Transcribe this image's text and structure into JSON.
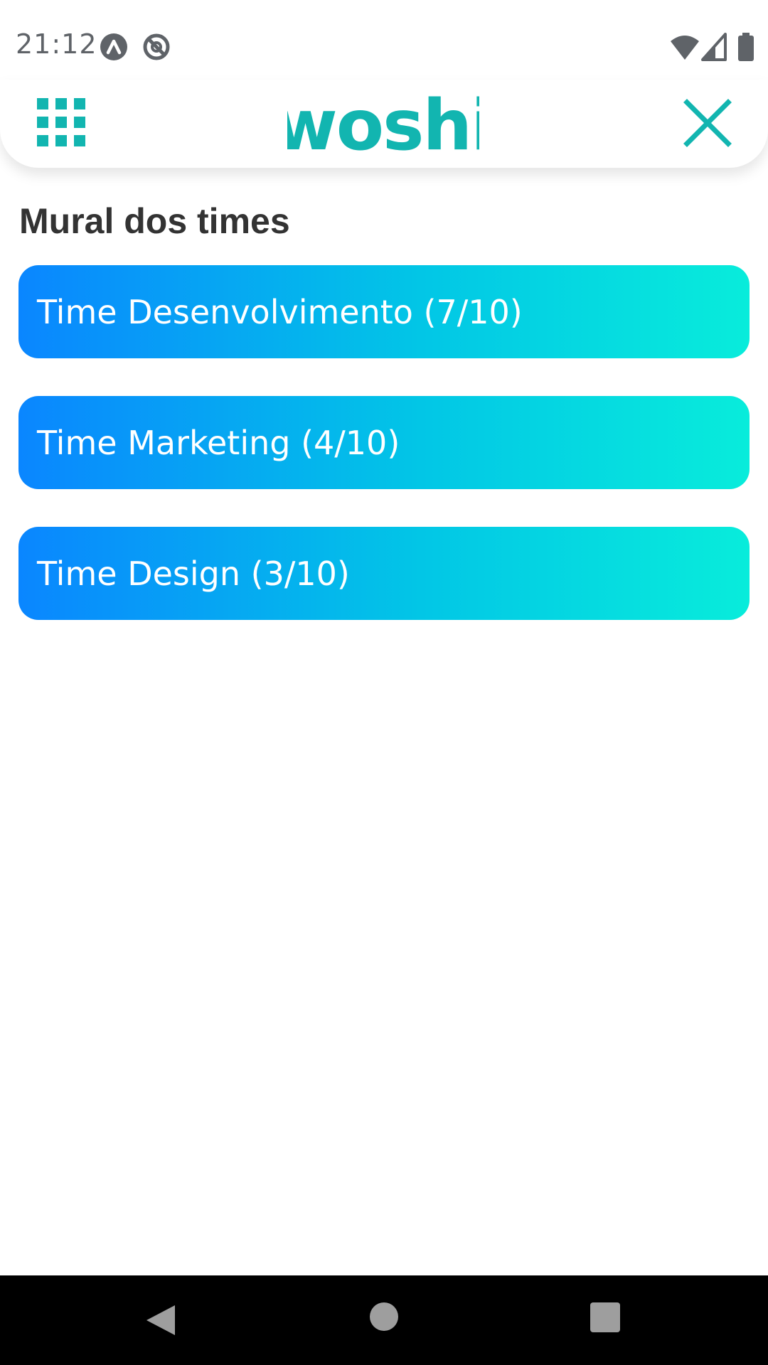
{
  "status_bar": {
    "time": "21:12",
    "left_icons": [
      "app-notification-icon",
      "at-sign-icon"
    ],
    "right_icons": [
      "wifi-icon",
      "cell-signal-icon",
      "battery-icon"
    ]
  },
  "header": {
    "logo_text": "woshi",
    "menu_icon": "grid-menu-icon",
    "close_icon": "close-icon",
    "accent_color": "#12b5b0"
  },
  "main": {
    "title": "Mural dos times",
    "teams": [
      {
        "label": "Time Desenvolvimento (7/10)"
      },
      {
        "label": "Time Marketing (4/10)"
      },
      {
        "label": "Time Design (3/10)"
      }
    ],
    "card_gradient": [
      "#0a86ff",
      "#08ecdb"
    ]
  },
  "nav_bar": {
    "buttons": [
      "back-icon",
      "home-icon",
      "recents-icon"
    ]
  }
}
